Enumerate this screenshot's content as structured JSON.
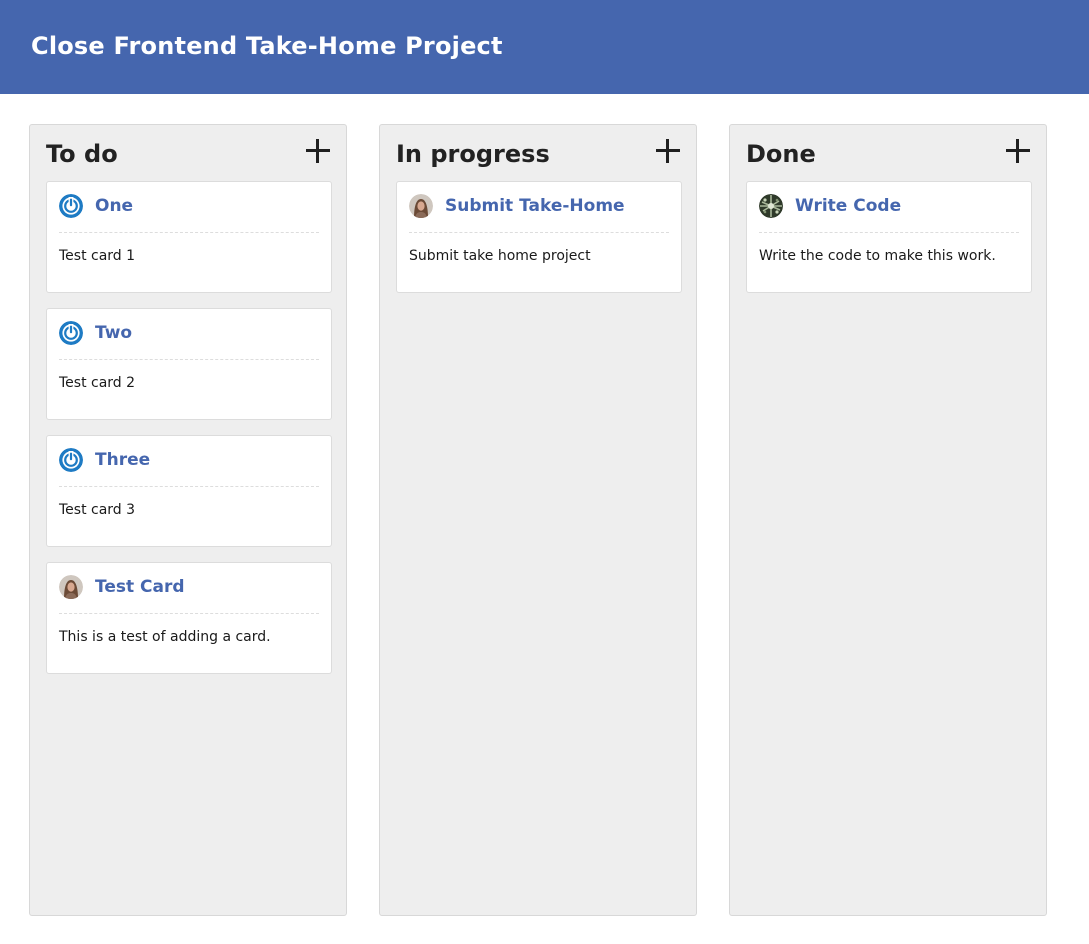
{
  "app": {
    "title": "Close Frontend Take-Home Project"
  },
  "colors": {
    "header_bg": "#4566ae",
    "card_title": "#4566ae",
    "column_bg": "#eeeeee",
    "power_icon": "#1e7bc4"
  },
  "columns": [
    {
      "title": "To do",
      "add_icon": "plus-icon",
      "cards": [
        {
          "title": "One",
          "body": "Test card 1",
          "avatar": "power-icon"
        },
        {
          "title": "Two",
          "body": "Test card 2",
          "avatar": "power-icon"
        },
        {
          "title": "Three",
          "body": "Test card 3",
          "avatar": "power-icon"
        },
        {
          "title": "Test Card",
          "body": "This is a test of adding a card.",
          "avatar": "user-photo-avatar"
        }
      ]
    },
    {
      "title": "In progress",
      "add_icon": "plus-icon",
      "cards": [
        {
          "title": "Submit Take-Home",
          "body": "Submit take home project",
          "avatar": "user-photo-avatar"
        }
      ]
    },
    {
      "title": "Done",
      "add_icon": "plus-icon",
      "cards": [
        {
          "title": "Write Code",
          "body": "Write the code to make this work.",
          "avatar": "pattern-avatar"
        }
      ]
    }
  ]
}
